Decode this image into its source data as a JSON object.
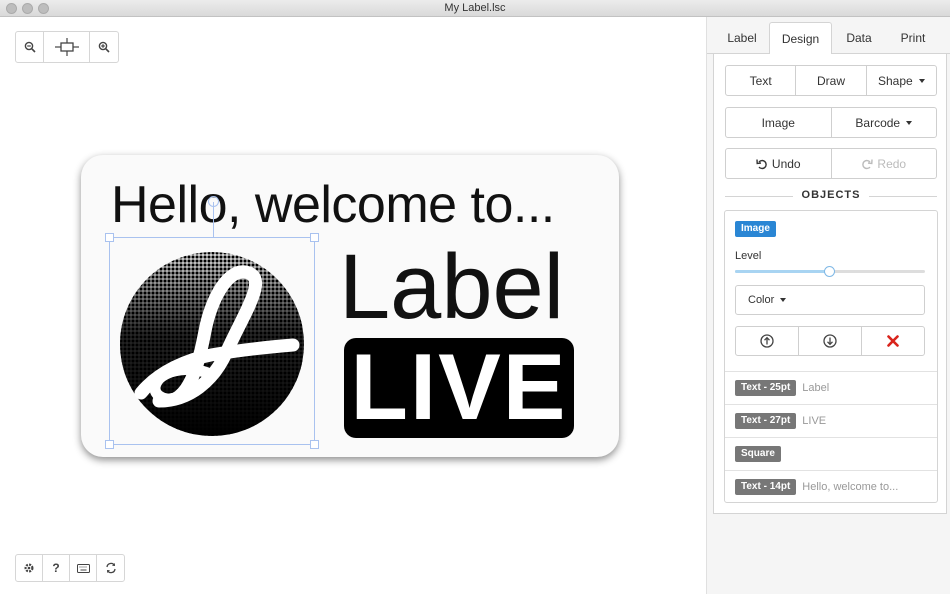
{
  "window": {
    "title": "My Label.lsc"
  },
  "canvas": {
    "label": {
      "line1": "Hello, welcome to...",
      "logo_text": "Label",
      "logo_badge": "LIVE"
    }
  },
  "tabs": [
    {
      "label": "Label",
      "active": false
    },
    {
      "label": "Design",
      "active": true
    },
    {
      "label": "Data",
      "active": false
    },
    {
      "label": "Print",
      "active": false
    }
  ],
  "design": {
    "text_button": "Text",
    "draw_button": "Draw",
    "shape_button": "Shape",
    "image_button": "Image",
    "barcode_button": "Barcode",
    "undo_button": "Undo",
    "redo_button": "Redo",
    "objects_heading": "OBJECTS"
  },
  "selected_object": {
    "type_badge": "Image",
    "level_label": "Level",
    "level_value": 0.5,
    "color_button": "Color"
  },
  "objects": [
    {
      "badge": "Text - 25pt",
      "name": "Label"
    },
    {
      "badge": "Text - 27pt",
      "name": "LIVE"
    },
    {
      "badge": "Square",
      "name": ""
    },
    {
      "badge": "Text - 14pt",
      "name": "Hello, welcome to..."
    }
  ],
  "colors": {
    "accent": "#2a86d4",
    "delete": "#d9241c",
    "badge_gray": "#777777"
  }
}
